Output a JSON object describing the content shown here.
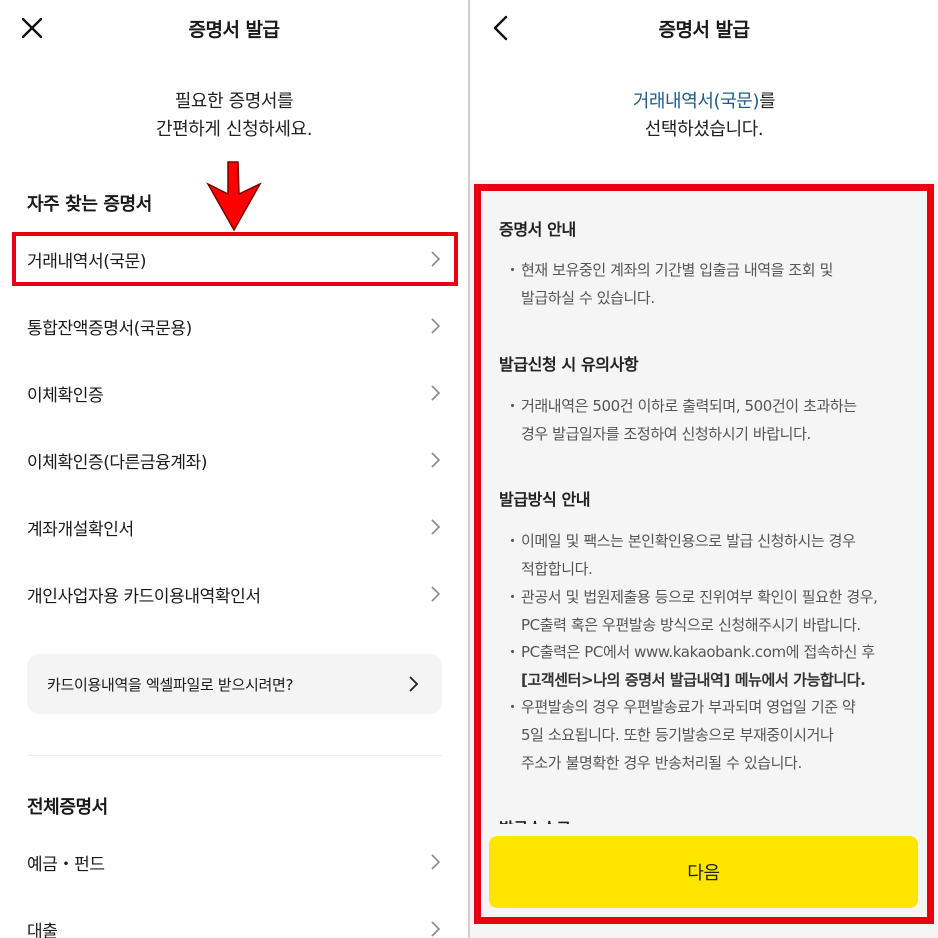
{
  "left": {
    "header": {
      "title": "증명서 발급",
      "nav_icon": "close-icon"
    },
    "intro": {
      "line1": "필요한 증명서를",
      "line2": "간편하게 신청하세요."
    },
    "frequent": {
      "title": "자주 찾는 증명서",
      "items": [
        {
          "label": "거래내역서(국문)"
        },
        {
          "label": "통합잔액증명서(국문용)"
        },
        {
          "label": "이체확인증"
        },
        {
          "label": "이체확인증(다른금융계좌)"
        },
        {
          "label": "계좌개설확인서"
        },
        {
          "label": "개인사업자용 카드이용내역확인서"
        }
      ]
    },
    "excel_card": {
      "label": "카드이용내역을 엑셀파일로 받으시려면?"
    },
    "all": {
      "title": "전체증명서",
      "items": [
        {
          "label": "예금・펀드"
        },
        {
          "label": "대출"
        }
      ]
    },
    "annotation_color": "#e60012"
  },
  "right": {
    "header": {
      "title": "증명서 발급",
      "nav_icon": "back-chevron-icon"
    },
    "intro": {
      "accent": "거래내역서(국문)",
      "line1_suffix": "를",
      "line2": "선택하셨습니다."
    },
    "sections": [
      {
        "heading": "증명서 안내",
        "bullets": [
          {
            "lines": [
              "현재 보유중인 계좌의 기간별 입출금 내역을 조회 및",
              "발급하실 수 있습니다."
            ]
          }
        ]
      },
      {
        "heading": "발급신청 시 유의사항",
        "bullets": [
          {
            "lines": [
              "거래내역은 500건 이하로 출력되며, 500건이 초과하는",
              "경우 발급일자를 조정하여 신청하시기 바랍니다."
            ]
          }
        ]
      },
      {
        "heading": "발급방식 안내",
        "bullets": [
          {
            "lines": [
              "이메일 및 팩스는 본인확인용으로 발급 신청하시는 경우",
              "적합합니다."
            ]
          },
          {
            "lines": [
              "관공서 및 법원제출용 등으로 진위여부 확인이 필요한 경우,",
              "PC출력 혹은 우편발송 방식으로 신청해주시기 바랍니다."
            ]
          },
          {
            "lines": [
              "PC출력은 PC에서 www.kakaobank.com에 접속하신 후",
              "[고객센터>나의 증명서 발급내역] 메뉴에서 가능합니다."
            ]
          },
          {
            "lines": [
              "우편발송의 경우 우편발송료가 부과되며 영업일 기준 약",
              "5일 소요됩니다. 또한 등기발송으로 부재중이시거나",
              "주소가 불명확한 경우 반송처리될 수 있습니다."
            ]
          }
        ]
      },
      {
        "heading": "발급수수료",
        "bullets": []
      }
    ],
    "bullet_char": "・",
    "next_button": {
      "label": "다음"
    },
    "button_color": "#fee500",
    "accent_color": "#1f5c8f"
  }
}
